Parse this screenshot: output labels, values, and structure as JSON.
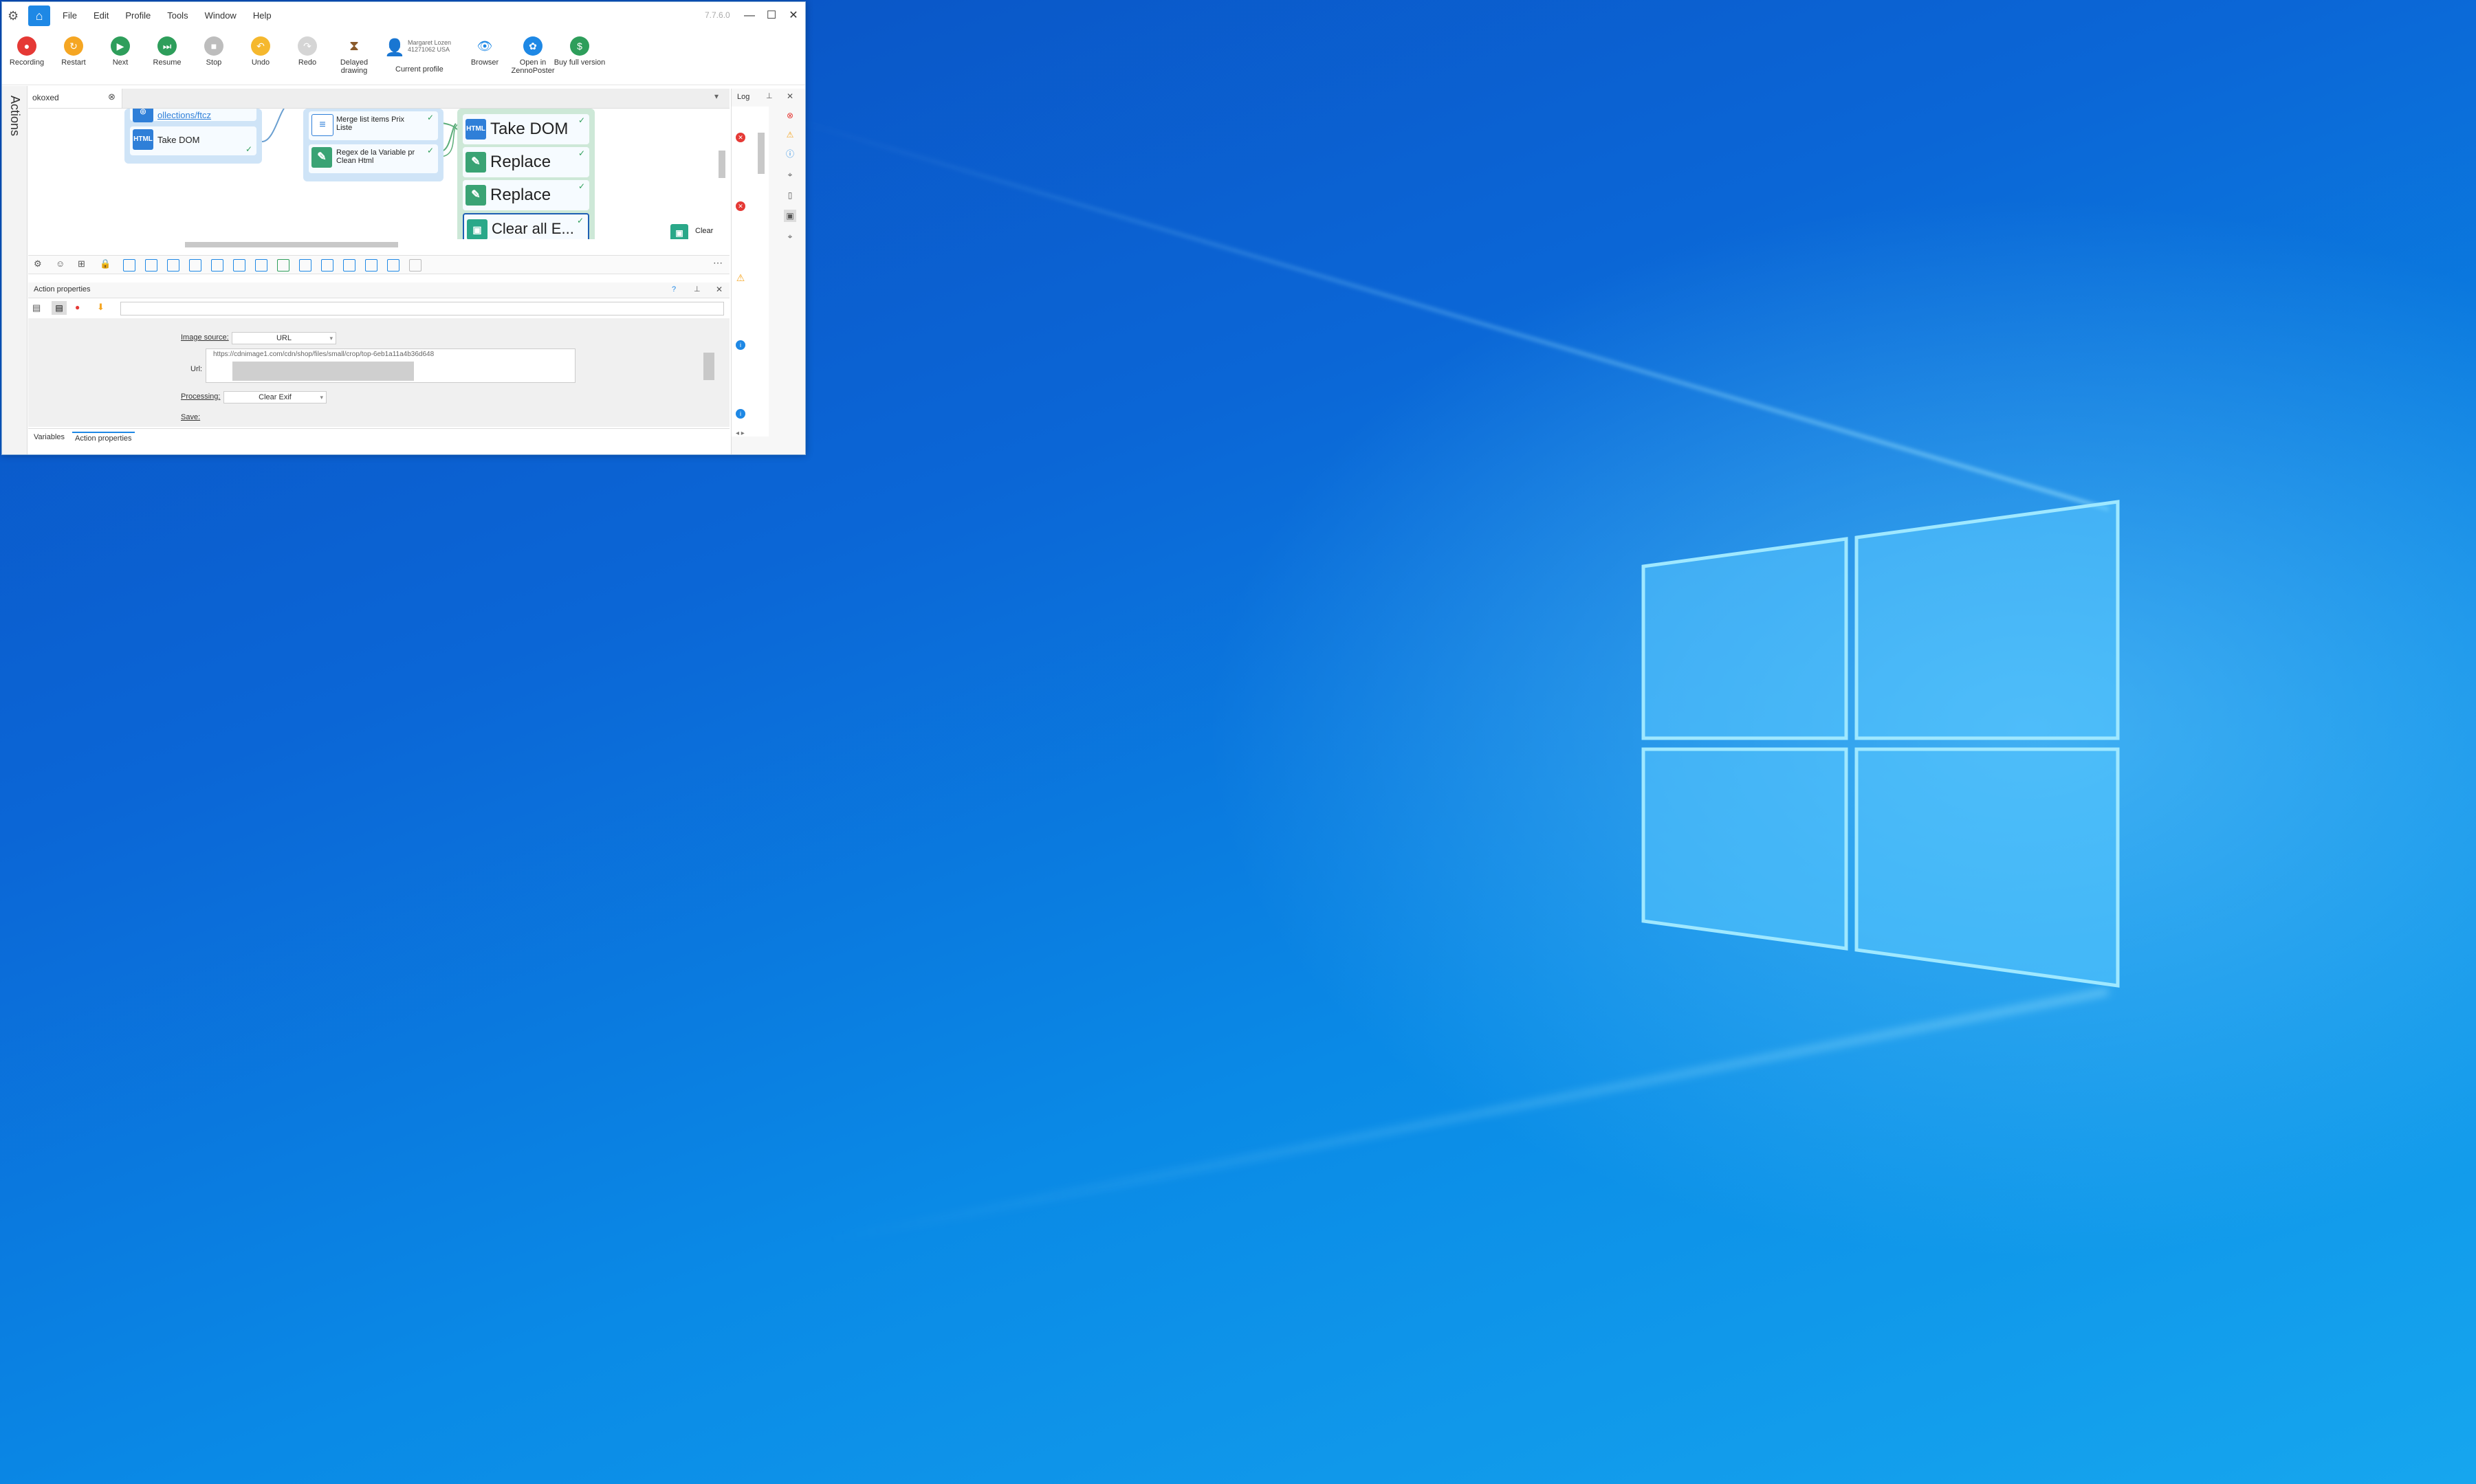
{
  "window": {
    "version": "7.7.6.0",
    "menu": [
      "File",
      "Edit",
      "Profile",
      "Tools",
      "Window",
      "Help"
    ]
  },
  "ribbon": {
    "recording": "Recording",
    "restart": "Restart",
    "next": "Next",
    "resume": "Resume",
    "stop": "Stop",
    "undo": "Undo",
    "redo": "Redo",
    "delayed_drawing": "Delayed drawing",
    "profile_name": "Margaret Lozen 41271062 USA",
    "current_profile": "Current profile",
    "browser": "Browser",
    "open_zennoposter": "Open in ZennoPoster",
    "buy_full": "Buy full version"
  },
  "actions_sidebar": "Actions",
  "project_tab": "okoxed",
  "canvas": {
    "nodes": {
      "link": "ollections/ftcz",
      "take_dom_small": "Take DOM",
      "merge_list": "Merge list items Prix Liste",
      "regex": "Regex de la Variable pr Clean Html",
      "take_dom_big": "Take DOM",
      "replace_1": "Replace",
      "replace_2": "Replace",
      "clear_all": "Clear all E...",
      "clear": "Clear"
    },
    "html_badge": "HTML"
  },
  "props": {
    "title": "Action properties",
    "image_source_label": "Image source:",
    "image_source_value": "URL",
    "url_label": "Url:",
    "url_value": "https://cdnimage1.com/cdn/shop/files/small/crop/top-6eb1a11a4b36d648",
    "processing_label": "Processing:",
    "processing_value": "Clear Exif",
    "save_label": "Save:"
  },
  "bottom_tabs": [
    "Variables",
    "Action properties"
  ],
  "log": {
    "title": "Log"
  },
  "colors": {
    "accent": "#1e88e5",
    "record": "#e53935",
    "restart": "#f5a623",
    "next": "#2e9e5b",
    "node_green": "#3aa374",
    "node_blue": "#2f7fd8"
  }
}
